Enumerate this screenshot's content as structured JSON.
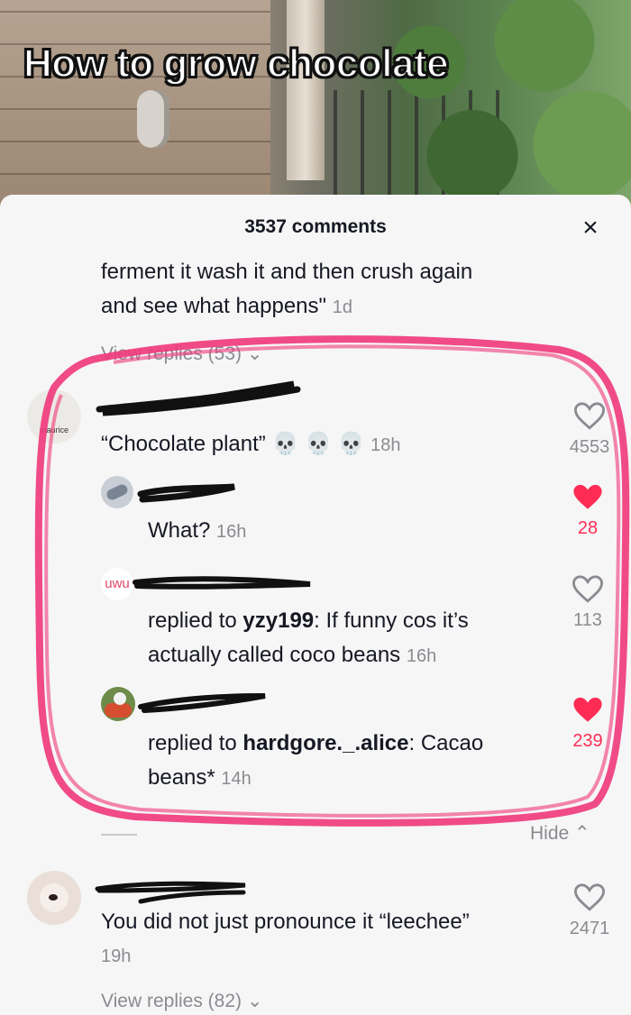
{
  "video": {
    "title": "How to grow chocolate"
  },
  "sheet": {
    "comments_count": "3537 comments",
    "close_icon": "×"
  },
  "prev_comment": {
    "text_line1": "ferment it wash it and then crush again",
    "text_line2": "and see what happens\"",
    "time": "1d",
    "view_replies": "View replies (53)"
  },
  "comment1": {
    "avatar_text": "maurice",
    "text": "“Chocolate plant”",
    "emojis": "💀 💀 💀",
    "time": "18h",
    "likes": "4553",
    "liked": false
  },
  "reply1": {
    "text": "What?",
    "time": "16h",
    "likes": "28",
    "liked": true
  },
  "reply2": {
    "avatar_text": "uwu",
    "prefix": "replied to ",
    "target": "yzy199",
    "text_rest": ": If funny cos it’s",
    "text_line2": "actually called coco beans",
    "time": "16h",
    "likes": "113",
    "liked": false
  },
  "reply3": {
    "prefix": "replied to ",
    "target": "hardgore._.alice",
    "text_rest": ": Cacao",
    "text_line2": "beans*",
    "time": "14h",
    "likes": "239",
    "liked": true
  },
  "hide": {
    "label": "Hide"
  },
  "comment2": {
    "text": "You did not just pronounce it “leechee”",
    "time": "19h",
    "likes": "2471",
    "liked": false,
    "view_replies": "View replies (82)"
  },
  "colors": {
    "accent": "#fe2c55",
    "highlight": "#f0397a",
    "muted": "#8a8b91"
  }
}
